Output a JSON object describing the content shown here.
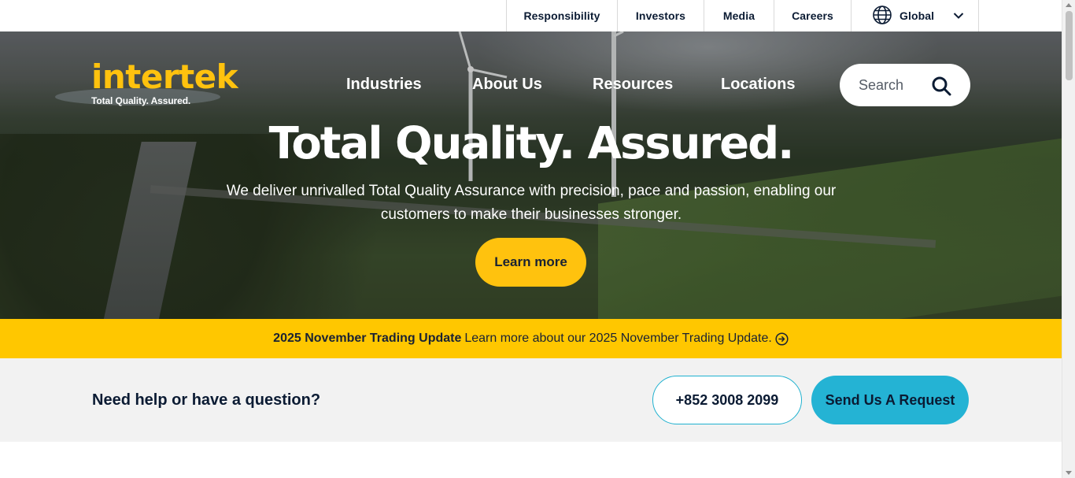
{
  "top_nav": {
    "items": [
      {
        "label": "Responsibility"
      },
      {
        "label": "Investors"
      },
      {
        "label": "Media"
      },
      {
        "label": "Careers"
      }
    ],
    "region": {
      "label": "Global",
      "icon": "globe-icon",
      "chevron": "chevron-down-icon"
    }
  },
  "brand": {
    "name": "intertek",
    "tagline": "Total Quality. Assured.",
    "color": "#ffc20e"
  },
  "main_nav": {
    "items": [
      {
        "label": "Industries"
      },
      {
        "label": "About Us"
      },
      {
        "label": "Resources"
      },
      {
        "label": "Locations"
      }
    ]
  },
  "search": {
    "placeholder": "Search",
    "icon": "search-icon"
  },
  "hero": {
    "headline": "Total Quality. Assured.",
    "subline": "We deliver unrivalled Total Quality Assurance with precision, pace and passion, enabling our customers to make their businesses stronger.",
    "cta_label": "Learn more",
    "cta_color": "#ffc20e"
  },
  "notice": {
    "title": "2025 November Trading Update",
    "text": "Learn more about our 2025 November Trading Update.",
    "icon": "arrow-circle-right-icon",
    "background": "#ffc700"
  },
  "help": {
    "question": "Need help or have a question?",
    "phone": "+852 3008 2099",
    "request_label": "Send Us A Request",
    "accent": "#24b3d4"
  }
}
